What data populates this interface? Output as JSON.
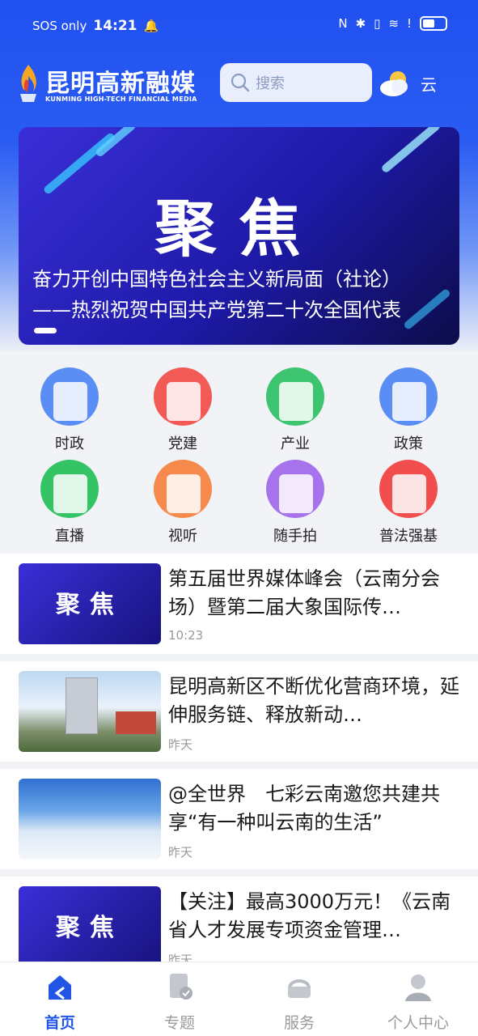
{
  "status_bar": {
    "carrier": "SOS only",
    "time": "14:21"
  },
  "header": {
    "logo_name": "昆明高新融媒",
    "logo_sub": "KUNMING HIGH-TECH FINANCIAL MEDIA",
    "search_placeholder": "搜索",
    "weather_text": "云"
  },
  "banner": {
    "big_text": "聚焦",
    "caption_line1": "奋力开创中国特色社会主义新局面（社论）",
    "caption_line2": "——热烈祝贺中国共产党第二十次全国代表"
  },
  "categories": [
    {
      "label": "时政",
      "icon": "newspaper-icon",
      "color": "#5b8ef5"
    },
    {
      "label": "党建",
      "icon": "party-emblem-icon",
      "color": "#f25a55"
    },
    {
      "label": "产业",
      "icon": "building-icon",
      "color": "#3cc46e"
    },
    {
      "label": "政策",
      "icon": "policy-star-icon",
      "color": "#5b8ef5"
    },
    {
      "label": "直播",
      "icon": "live-play-icon",
      "color": "#34c466"
    },
    {
      "label": "视听",
      "icon": "video-play-icon",
      "color": "#f58a4c"
    },
    {
      "label": "随手拍",
      "icon": "camera-icon",
      "color": "#a673ec"
    },
    {
      "label": "普法强基",
      "icon": "books-icon",
      "color": "#f24e4e"
    }
  ],
  "news": [
    {
      "title": "第五届世界媒体峰会（云南分会场）暨第二届大象国际传…",
      "time": "10:23",
      "thumb": "聚焦"
    },
    {
      "title": "昆明高新区不断优化营商环境，延伸服务链、释放新动…",
      "time": "昨天",
      "thumb": ""
    },
    {
      "title": "@全世界　七彩云南邀您共建共享“有一种叫云南的生活”",
      "time": "昨天",
      "thumb": ""
    },
    {
      "title": "【关注】最高3000万元！《云南省人才发展专项资金管理…",
      "time": "昨天",
      "thumb": "聚焦"
    }
  ],
  "tabs": [
    {
      "label": "首页",
      "icon": "home-icon",
      "active": true
    },
    {
      "label": "专题",
      "icon": "topic-icon",
      "active": false
    },
    {
      "label": "服务",
      "icon": "service-icon",
      "active": false
    },
    {
      "label": "个人中心",
      "icon": "profile-icon",
      "active": false
    }
  ],
  "colors": {
    "brand_blue": "#2255e6",
    "banner_purple": "#2a22c2"
  }
}
